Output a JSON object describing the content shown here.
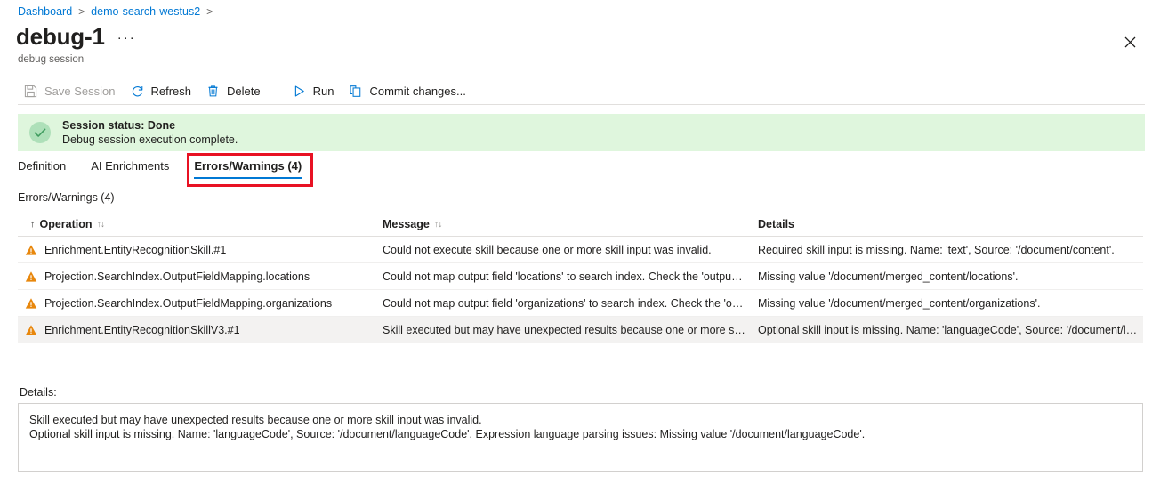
{
  "breadcrumb": {
    "items": [
      {
        "label": "Dashboard",
        "icon": ""
      },
      {
        "label": "demo-search-westus2",
        "icon": ""
      }
    ],
    "separator": ">"
  },
  "header": {
    "title": "debug-1",
    "ellipsis_label": "···",
    "subtitle": "debug session",
    "close_icon": "close-icon"
  },
  "toolbar": {
    "items": [
      {
        "label": "Save Session",
        "icon": "save-icon",
        "disabled": true
      },
      {
        "label": "Refresh",
        "icon": "refresh-icon",
        "disabled": false
      },
      {
        "label": "Delete",
        "icon": "trash-icon",
        "disabled": false
      },
      {
        "label": "Run",
        "icon": "play-icon",
        "disabled": false
      },
      {
        "label": "Commit changes...",
        "icon": "copy-icon",
        "disabled": false
      }
    ]
  },
  "status_banner": {
    "icon": "success-check-icon",
    "title": "Session status: Done",
    "subtitle": "Debug session execution complete.",
    "background_color": "#dff6dd",
    "accent_color": "#4caf74"
  },
  "tabs": [
    {
      "label": "Definition",
      "selected": false
    },
    {
      "label": "AI Enrichments",
      "selected": false
    },
    {
      "label": "Errors/Warnings (4)",
      "selected": true
    }
  ],
  "annotation": {
    "color": "#e81123",
    "target": "Errors/Warnings (4)"
  },
  "section": {
    "label": "Errors/Warnings (4)"
  },
  "table": {
    "columns": [
      {
        "key": "operation",
        "label": "Operation",
        "sort_prefix": "↑",
        "sort_icon": "↑↓",
        "sortable": true
      },
      {
        "key": "message",
        "label": "Message",
        "sort_prefix": "",
        "sort_icon": "↑↓",
        "sortable": true
      },
      {
        "key": "details",
        "label": "Details",
        "sort_prefix": "",
        "sort_icon": "",
        "sortable": false
      }
    ],
    "rows": [
      {
        "icon": "warning-icon",
        "operation": "Enrichment.EntityRecognitionSkill.#1",
        "message": "Could not execute skill because one or more skill input was invalid.",
        "details": "Required skill input is missing. Name: 'text', Source: '/document/content'.",
        "selected": false
      },
      {
        "icon": "warning-icon",
        "operation": "Projection.SearchIndex.OutputFieldMapping.locations",
        "message": "Could not map output field 'locations' to search index. Check the 'outputFi…",
        "details": "Missing value '/document/merged_content/locations'.",
        "selected": false
      },
      {
        "icon": "warning-icon",
        "operation": "Projection.SearchIndex.OutputFieldMapping.organizations",
        "message": "Could not map output field 'organizations' to search index. Check the 'outp…",
        "details": "Missing value '/document/merged_content/organizations'.",
        "selected": false
      },
      {
        "icon": "warning-icon",
        "operation": "Enrichment.EntityRecognitionSkillV3.#1",
        "message": "Skill executed but may have unexpected results because one or more skill i…",
        "details": "Optional skill input is missing. Name: 'languageCode', Source: '/document/l…",
        "selected": true
      }
    ]
  },
  "details_panel": {
    "label": "Details:",
    "lines": [
      "Skill executed but may have unexpected results because one or more skill input was invalid.",
      "Optional skill input is missing. Name: 'languageCode', Source: '/document/languageCode'. Expression language parsing issues: Missing value '/document/languageCode'."
    ]
  },
  "colors": {
    "link": "#0078d4",
    "accent": "#0078d4",
    "warning": "#d97706",
    "success": "#107c10",
    "annotation": "#e81123",
    "text": "#201f1e",
    "muted": "#605e5c"
  }
}
